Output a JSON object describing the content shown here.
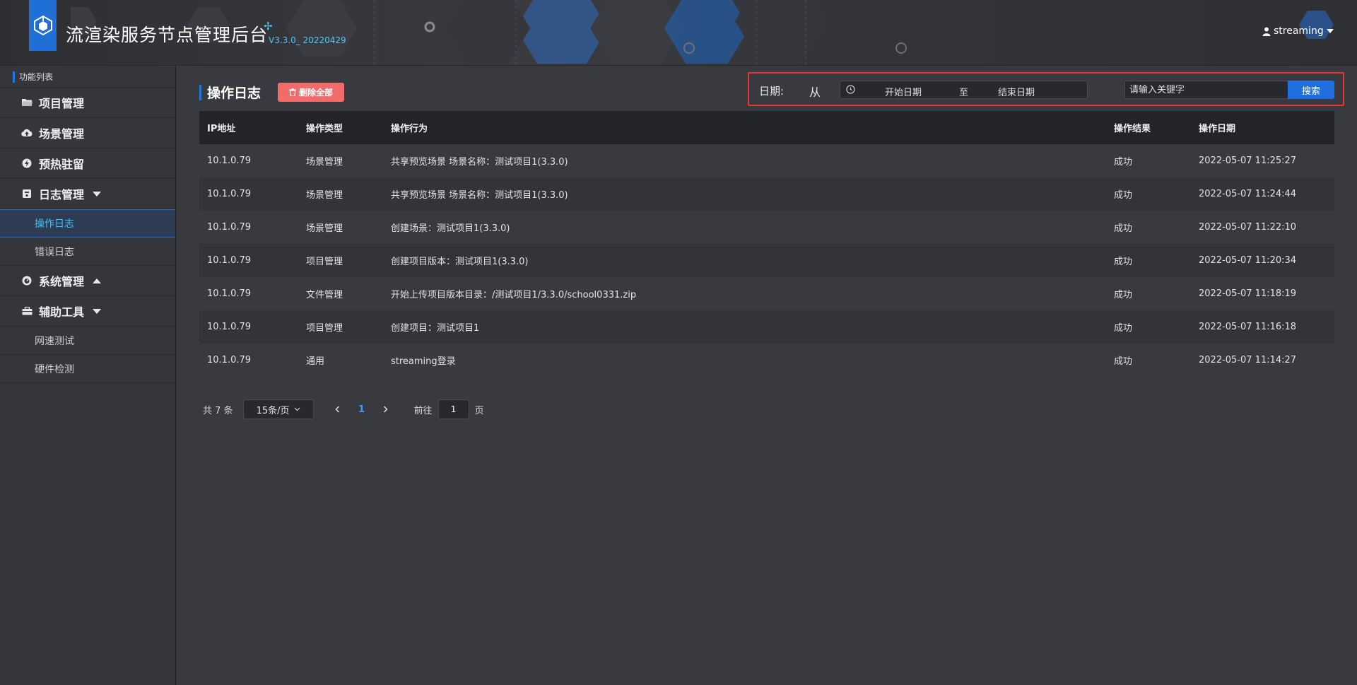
{
  "header": {
    "title": "流渲染服务节点管理后台",
    "version": "V3.3.0_ 20220429",
    "user": "streaming"
  },
  "sidebar": {
    "title": "功能列表",
    "items": [
      {
        "label": "项目管理",
        "icon": "folder-icon"
      },
      {
        "label": "场景管理",
        "icon": "cloud-icon"
      },
      {
        "label": "预热驻留",
        "icon": "bolt-icon"
      },
      {
        "label": "日志管理",
        "icon": "log-icon",
        "expanded": true,
        "children": [
          {
            "label": "操作日志",
            "active": true
          },
          {
            "label": "错误日志"
          }
        ]
      },
      {
        "label": "系统管理",
        "icon": "gauge-icon",
        "expanded": false
      },
      {
        "label": "辅助工具",
        "icon": "toolbox-icon",
        "expanded": true,
        "children": [
          {
            "label": "网速测试"
          },
          {
            "label": "硬件检测"
          }
        ]
      }
    ]
  },
  "main": {
    "page_title": "操作日志",
    "delete_all_label": "删除全部",
    "filter": {
      "date_label": "日期:",
      "from_label": "从",
      "start_placeholder": "开始日期",
      "separator": "至",
      "end_placeholder": "结束日期",
      "search_placeholder": "请输入关键字",
      "search_button": "搜索"
    },
    "table": {
      "columns": [
        "IP地址",
        "操作类型",
        "操作行为",
        "操作结果",
        "操作日期"
      ],
      "rows": [
        [
          "10.1.0.79",
          "场景管理",
          "共享预览场景 场景名称：测试项目1(3.3.0)",
          "成功",
          "2022-05-07 11:25:27"
        ],
        [
          "10.1.0.79",
          "场景管理",
          "共享预览场景 场景名称：测试项目1(3.3.0)",
          "成功",
          "2022-05-07 11:24:44"
        ],
        [
          "10.1.0.79",
          "场景管理",
          "创建场景：测试项目1(3.3.0)",
          "成功",
          "2022-05-07 11:22:10"
        ],
        [
          "10.1.0.79",
          "项目管理",
          "创建项目版本：测试项目1(3.3.0)",
          "成功",
          "2022-05-07 11:20:34"
        ],
        [
          "10.1.0.79",
          "文件管理",
          "开始上传项目版本目录：/测试项目1/3.3.0/school0331.zip",
          "成功",
          "2022-05-07 11:18:19"
        ],
        [
          "10.1.0.79",
          "项目管理",
          "创建项目：测试项目1",
          "成功",
          "2022-05-07 11:16:18"
        ],
        [
          "10.1.0.79",
          "通用",
          "streaming登录",
          "成功",
          "2022-05-07 11:14:27"
        ]
      ]
    },
    "pagination": {
      "total": "共 7 条",
      "page_size": "15条/页",
      "current_page": "1",
      "goto_label": "前往",
      "goto_value": "1",
      "page_suffix": "页"
    }
  },
  "colors": {
    "accent": "#1f6fe0",
    "active_text": "#39c6ff",
    "danger": "#f26b6b",
    "highlight_border": "#e53935"
  }
}
